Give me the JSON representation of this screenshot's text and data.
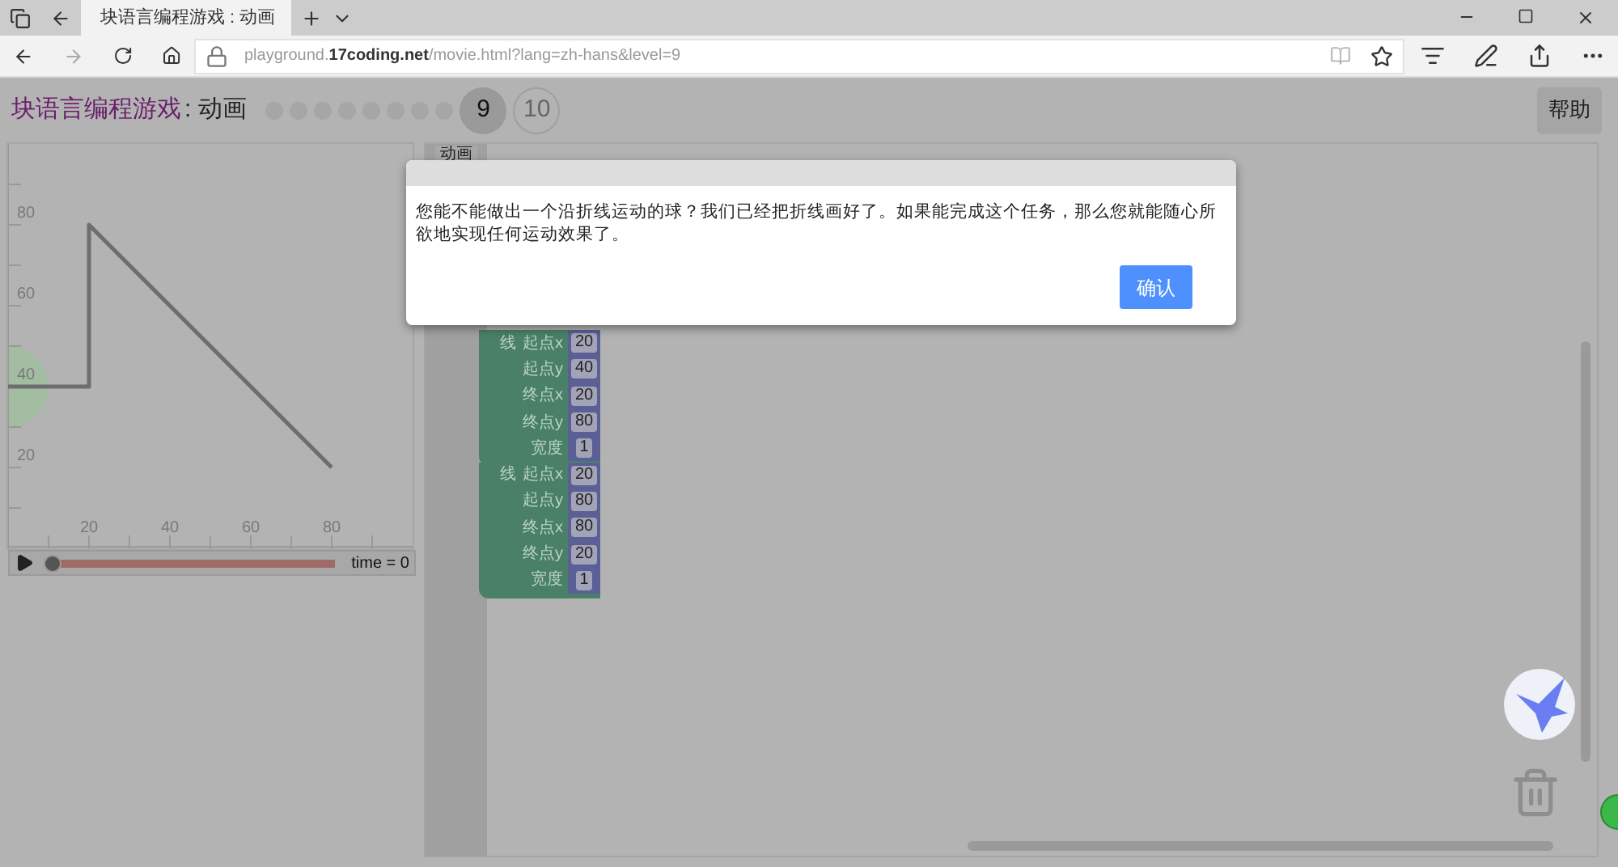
{
  "browser": {
    "tab_title": "块语言编程游戏 : 动画",
    "url": "playground.**17coding.net**/movie.html?lang=zh-hans&level=9"
  },
  "header": {
    "title": "块语言编程游戏",
    "subtitle": ": 动画",
    "help_button": "帮助"
  },
  "levels": [
    {
      "kind": "dot",
      "selected": false
    },
    {
      "kind": "dot",
      "selected": false
    },
    {
      "kind": "dot",
      "selected": false
    },
    {
      "kind": "dot",
      "selected": false
    },
    {
      "kind": "dot",
      "selected": false
    },
    {
      "kind": "dot",
      "selected": false
    },
    {
      "kind": "dot",
      "selected": false
    },
    {
      "kind": "dot",
      "selected": false
    },
    {
      "kind": "number",
      "label": "9",
      "selected": true
    },
    {
      "kind": "number",
      "label": "10",
      "selected": false
    }
  ],
  "stage": {
    "chart_data": {
      "type": "line",
      "x": [
        0,
        20,
        20,
        80
      ],
      "series": [
        {
          "color": "#6e6e6e",
          "values": [
            40,
            40,
            80,
            20
          ]
        }
      ],
      "xlim": [
        0,
        100
      ],
      "ylim": [
        0,
        100
      ],
      "xticks": [
        20,
        40,
        60,
        80
      ],
      "yticks": [
        20,
        40,
        60,
        80
      ]
    },
    "player": {
      "level": 0,
      "time": "time = 0"
    }
  },
  "toolbox": {
    "tab": "动画"
  },
  "blocks": [
    {
      "label": "线",
      "fields": [
        {
          "label": "起点x",
          "value": "20"
        },
        {
          "label": "起点y",
          "value": "40"
        },
        {
          "label": "终点x",
          "value": "20"
        },
        {
          "label": "终点y",
          "value": "80"
        },
        {
          "label": "宽度",
          "value": "1"
        }
      ]
    },
    {
      "label": "线",
      "fields": [
        {
          "label": "起点x",
          "value": "20"
        },
        {
          "label": "起点y",
          "value": "80"
        },
        {
          "label": "终点x",
          "value": "80"
        },
        {
          "label": "终点y",
          "value": "20"
        },
        {
          "label": "宽度",
          "value": "1"
        }
      ]
    }
  ],
  "dialog": {
    "message": "您能不能做出一个沿折线运动的球？我们已经把折线画好了。如果能完成这个任务，那么您就能随心所欲地实现任何运动效果了。",
    "button": "确认"
  }
}
